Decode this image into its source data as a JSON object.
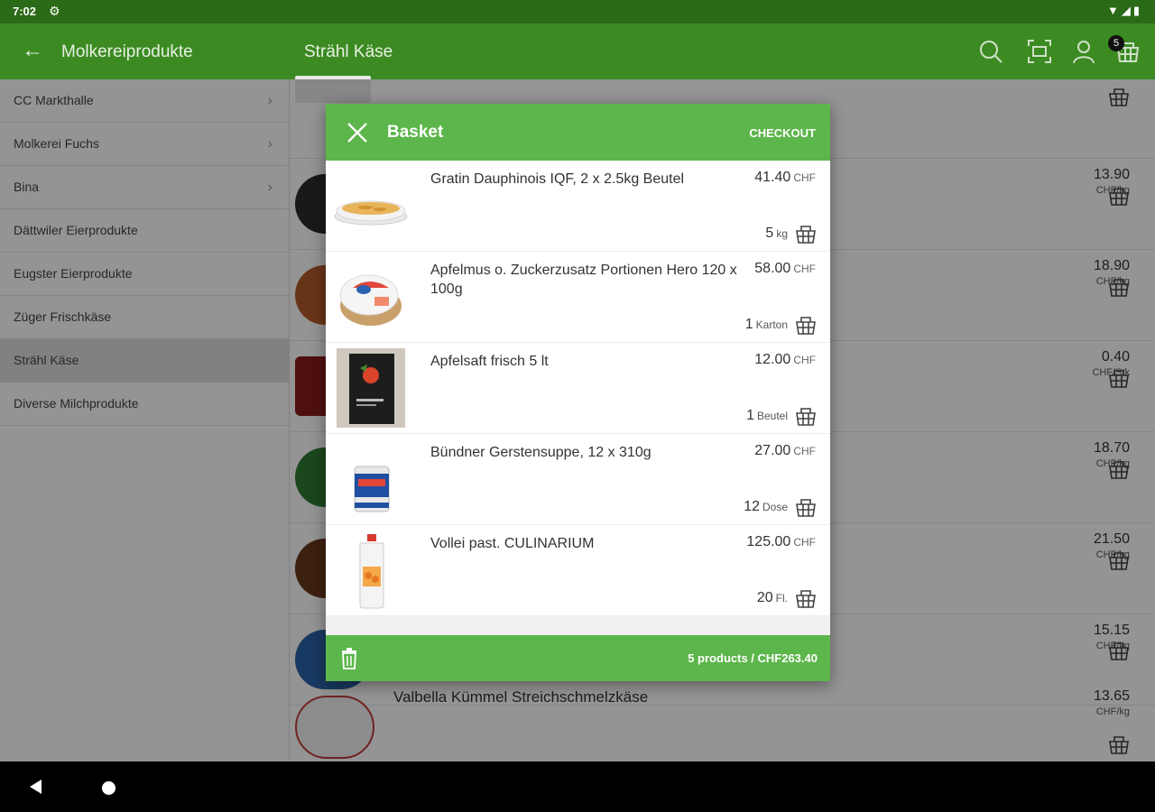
{
  "status_bar": {
    "time": "7:02"
  },
  "app_bar": {
    "category": "Molkereiprodukte",
    "subcategory": "Strähl Käse",
    "cart_badge": "5"
  },
  "sidebar": {
    "items": [
      {
        "label": "CC Markthalle"
      },
      {
        "label": "Molkerei Fuchs"
      },
      {
        "label": "Bina"
      },
      {
        "label": "Dättwiler Eierprodukte"
      },
      {
        "label": "Eugster Eierprodukte"
      },
      {
        "label": "Züger Frischkäse"
      },
      {
        "label": "Strähl Käse"
      },
      {
        "label": "Diverse Milchprodukte"
      }
    ]
  },
  "product_list": {
    "rows": [
      {
        "name": "",
        "price": "",
        "unit": ""
      },
      {
        "name": "",
        "price": "13.90",
        "unit": "CHF/kg"
      },
      {
        "name": "",
        "price": "18.90",
        "unit": "CHF/kg"
      },
      {
        "name": "",
        "price": "0.40",
        "unit": "CHF/Stk"
      },
      {
        "name": "",
        "price": "18.70",
        "unit": "CHF/kg"
      },
      {
        "name": "",
        "price": "21.50",
        "unit": "CHF/kg"
      },
      {
        "name": "",
        "price": "15.15",
        "unit": "CHF/kg"
      },
      {
        "name": "Valbella Kümmel Streichschmelzkäse",
        "price": "13.65",
        "unit": "CHF/kg"
      }
    ]
  },
  "basket": {
    "title": "Basket",
    "checkout_label": "CHECKOUT",
    "currency": "CHF",
    "items": [
      {
        "name": "Gratin Dauphinois IQF, 2 x 2.5kg Beutel",
        "price": "41.40",
        "qty": "5",
        "unit": "kg"
      },
      {
        "name": "Apfelmus o. Zuckerzusatz Portionen Hero 120 x 100g",
        "price": "58.00",
        "qty": "1",
        "unit": "Karton"
      },
      {
        "name": "Apfelsaft frisch 5 lt",
        "price": "12.00",
        "qty": "1",
        "unit": "Beutel"
      },
      {
        "name": "Bündner Gerstensuppe, 12 x 310g",
        "price": "27.00",
        "qty": "12",
        "unit": "Dose"
      },
      {
        "name": "Vollei  past.  CULINARIUM",
        "price": "125.00",
        "qty": "20",
        "unit": "Fl."
      }
    ],
    "summary": "5 products / CHF263.40"
  }
}
